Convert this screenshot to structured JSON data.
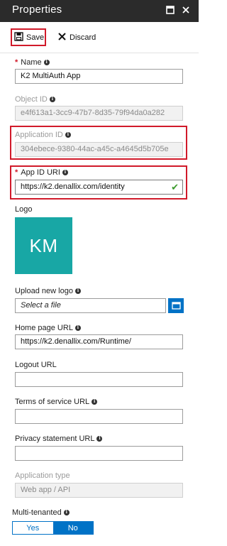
{
  "window": {
    "title": "Properties"
  },
  "toolbar": {
    "save_label": "Save",
    "discard_label": "Discard"
  },
  "fields": {
    "name": {
      "label": "Name",
      "value": "K2 MultiAuth App",
      "required": true
    },
    "object_id": {
      "label": "Object ID",
      "value": "e4f613a1-3cc9-47b7-8d35-79f94da0a282"
    },
    "application_id": {
      "label": "Application ID",
      "value": "304ebece-9380-44ac-a45c-a4645d5b705e"
    },
    "app_id_uri": {
      "label": "App ID URI",
      "value": "https://k2.denallix.com/identity",
      "required": true
    },
    "logo": {
      "label": "Logo",
      "initials": "KM"
    },
    "upload_logo": {
      "label": "Upload new logo",
      "placeholder": "Select a file"
    },
    "home_page_url": {
      "label": "Home page URL",
      "value": "https://k2.denallix.com/Runtime/"
    },
    "logout_url": {
      "label": "Logout URL",
      "value": ""
    },
    "terms_url": {
      "label": "Terms of service URL",
      "value": ""
    },
    "privacy_url": {
      "label": "Privacy statement URL",
      "value": ""
    },
    "application_type": {
      "label": "Application type",
      "value": "Web app / API"
    },
    "multi_tenanted": {
      "label": "Multi-tenanted",
      "options": [
        "Yes",
        "No"
      ],
      "selected": "No"
    }
  },
  "colors": {
    "accent": "#0072c6",
    "highlight": "#d11a2a",
    "logo_tile": "#18a7a5",
    "titlebar": "#2b2b2b"
  }
}
